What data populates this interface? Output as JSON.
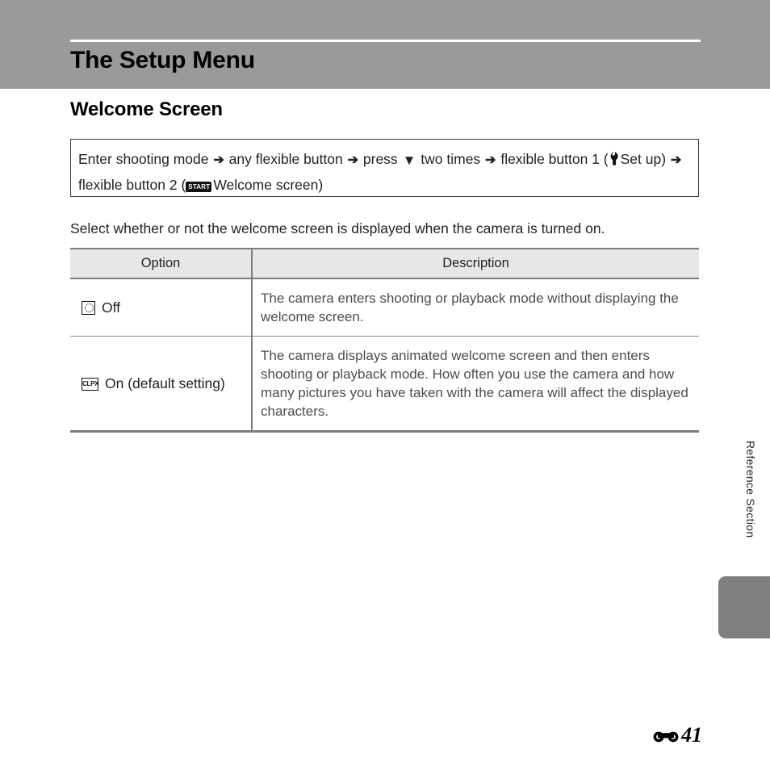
{
  "header": {
    "chapter_title": "The Setup Menu"
  },
  "section": {
    "title": "Welcome Screen"
  },
  "navigation": {
    "part1": "Enter shooting mode",
    "arrow1": "➔",
    "part2": "any flexible button",
    "arrow2": "➔",
    "part3": "press",
    "triangle_down": "▼",
    "part4": "two times",
    "arrow3": "➔",
    "part5": "flexible button 1 (",
    "setup_label": "Set up",
    "part6": ")",
    "arrow4": "➔",
    "part7": "flexible button 2 (",
    "start_badge_label": "START",
    "part8": "Welcome screen)"
  },
  "intro": {
    "text": "Select whether or not the welcome screen is displayed when the camera is turned on."
  },
  "table": {
    "columns": {
      "option": "Option",
      "description": "Description"
    },
    "rows": [
      {
        "icon": "off-icon",
        "option": "Off",
        "description": "The camera enters shooting or playback mode without displaying the welcome screen."
      },
      {
        "icon": "welcome-screen-on-icon",
        "icon_label": "CLPX",
        "option": "On (default setting)",
        "description": "The camera displays animated welcome screen and then enters shooting or playback mode. How often you use the camera and how many pictures you have taken with the camera will affect the displayed characters."
      }
    ]
  },
  "side": {
    "section_label": "Reference Section"
  },
  "footer": {
    "reference_mark": "reference-section-mark",
    "page_number": "41"
  },
  "colors": {
    "header_band": "#9a9a9a",
    "table_header_bg": "#e7e7e7",
    "side_tab": "#7f7f7f",
    "body_text": "#231f20",
    "description_text": "#4d4d4d"
  }
}
